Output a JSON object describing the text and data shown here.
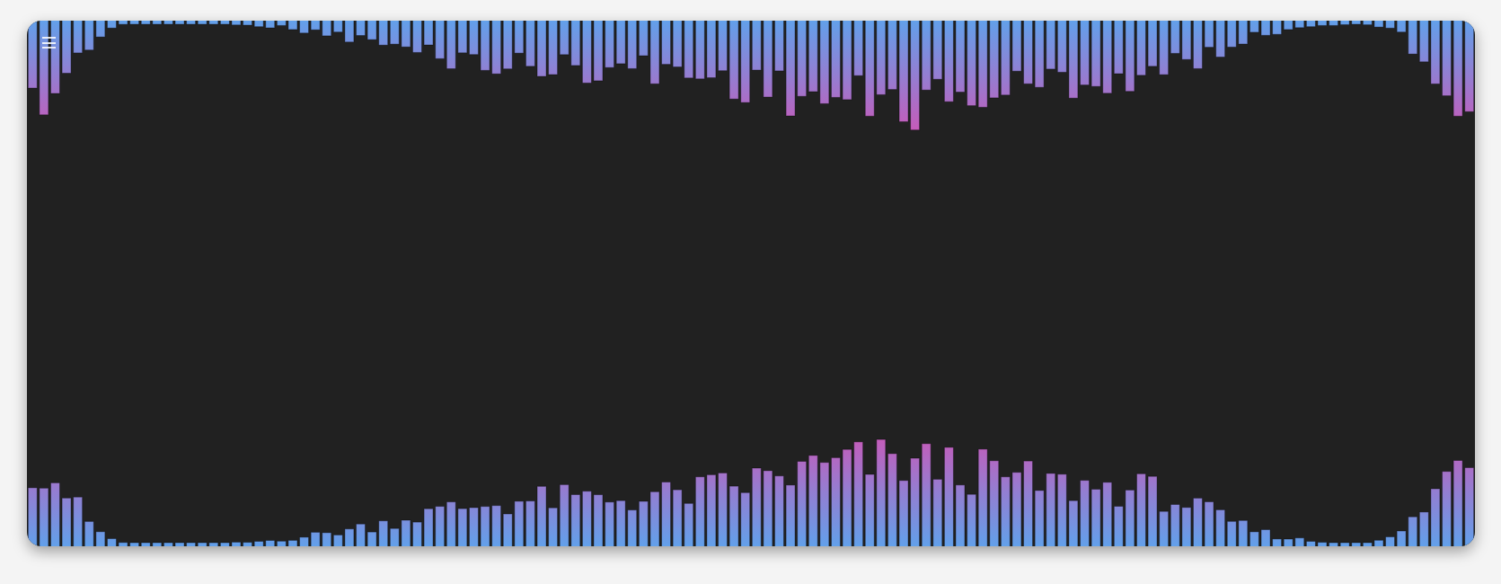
{
  "menu_button": {
    "kind": "hamburger"
  },
  "visualizer": {
    "kind": "spectrum"
  }
}
